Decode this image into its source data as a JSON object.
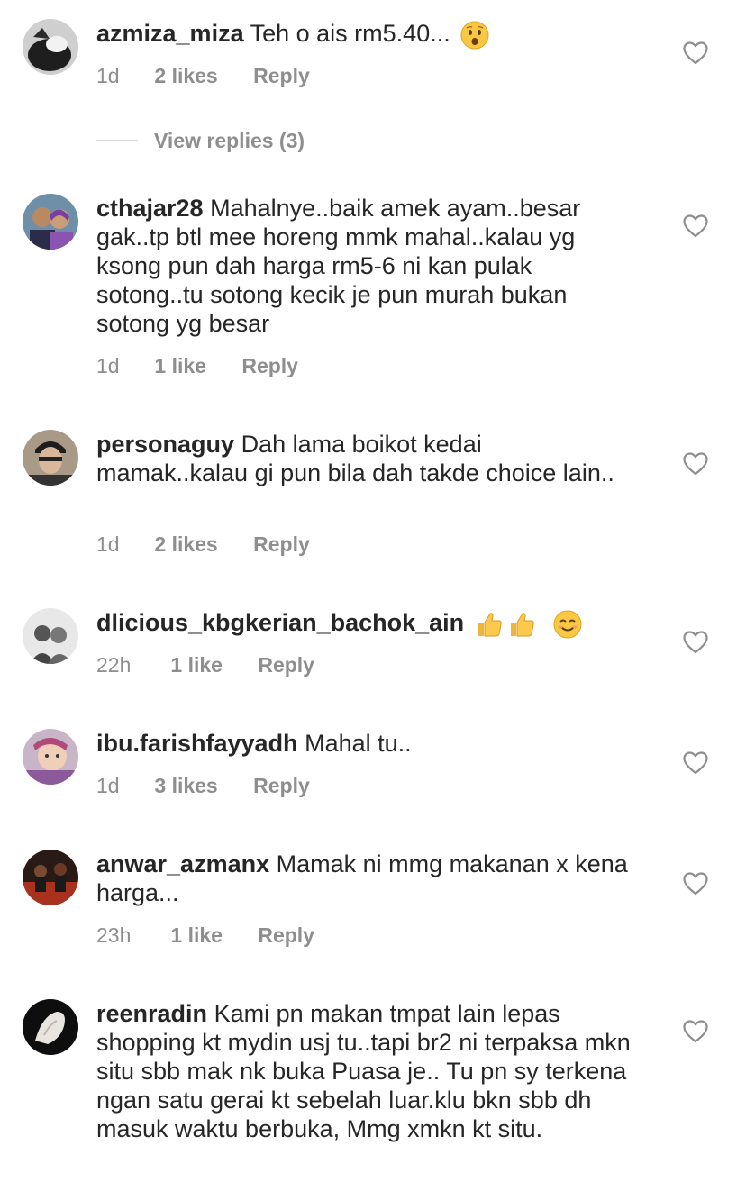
{
  "comments": [
    {
      "username": "azmiza_miza",
      "text": "Teh o ais rm5.40...",
      "emoji": "astonished-face",
      "time": "1d",
      "likes": "2 likes",
      "reply": "Reply"
    },
    {
      "username": "cthajar28",
      "text": "Mahalnye..baik amek ayam..besar gak..tp btl mee horeng mmk mahal..kalau yg ksong pun dah harga rm5-6 ni kan pulak sotong..tu sotong kecik je pun murah bukan sotong yg besar",
      "time": "1d",
      "likes": "1 like",
      "reply": "Reply"
    },
    {
      "username": "personaguy",
      "text": "Dah lama boikot kedai mamak..kalau gi pun bila dah takde choice lain..",
      "time": "1d",
      "likes": "2 likes",
      "reply": "Reply"
    },
    {
      "username": "dlicious_kbgkerian_bachok_ain",
      "text": "",
      "emoji": "thumbs-up thumbs-up smiling-face",
      "time": "22h",
      "likes": "1 like",
      "reply": "Reply"
    },
    {
      "username": "ibu.farishfayyadh",
      "text": "Mahal tu..",
      "time": "1d",
      "likes": "3 likes",
      "reply": "Reply"
    },
    {
      "username": "anwar_azmanx",
      "text": "Mamak ni mmg makanan x kena harga...",
      "time": "23h",
      "likes": "1 like",
      "reply": "Reply"
    },
    {
      "username": "reenradin",
      "text": "Kami pn makan tmpat lain lepas shopping kt mydin usj tu..tapi br2 ni terpaksa mkn situ sbb mak nk buka  Puasa je.. Tu pn sy terkena ngan satu gerai kt sebelah luar.klu bkn sbb dh masuk waktu berbuka, Mmg xmkn kt situ."
    }
  ],
  "view_replies": "View replies (3)",
  "colors": {
    "text": "#262626",
    "secondary": "#8e8e8e",
    "divider": "#dbdbdb"
  }
}
